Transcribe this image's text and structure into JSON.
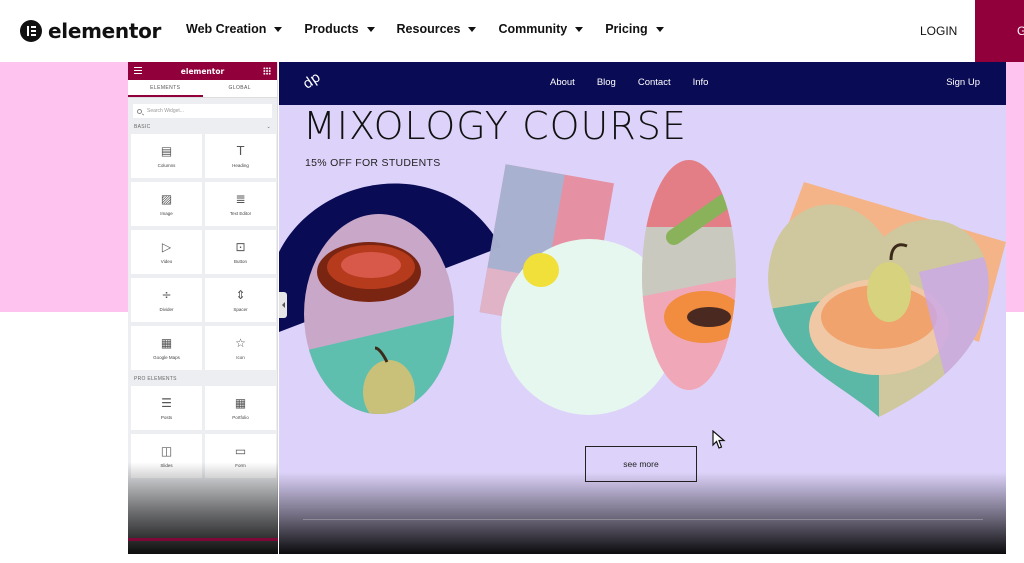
{
  "brand": {
    "name": "elementor"
  },
  "topnav": {
    "items": [
      {
        "label": "Web Creation"
      },
      {
        "label": "Products"
      },
      {
        "label": "Resources"
      },
      {
        "label": "Community"
      },
      {
        "label": "Pricing"
      }
    ],
    "login": "LOGIN",
    "cta_visible": "G"
  },
  "editor": {
    "title": "elementor",
    "tabs": [
      "ELEMENTS",
      "GLOBAL"
    ],
    "search_placeholder": "Search Widget...",
    "basic_label": "BASIC",
    "pro_label": "PRO ELEMENTS",
    "basic_widgets": [
      {
        "label": "Columns",
        "icon": "columns-icon",
        "glyph": "▤"
      },
      {
        "label": "Heading",
        "icon": "heading-icon",
        "glyph": "T"
      },
      {
        "label": "Image",
        "icon": "image-icon",
        "glyph": "▨"
      },
      {
        "label": "Text Editor",
        "icon": "text-editor-icon",
        "glyph": "≣"
      },
      {
        "label": "Video",
        "icon": "video-icon",
        "glyph": "▷"
      },
      {
        "label": "Button",
        "icon": "button-icon",
        "glyph": "⊡"
      },
      {
        "label": "Divider",
        "icon": "divider-icon",
        "glyph": "÷"
      },
      {
        "label": "Spacer",
        "icon": "spacer-icon",
        "glyph": "⇕"
      },
      {
        "label": "Google Maps",
        "icon": "map-icon",
        "glyph": "▦"
      },
      {
        "label": "Icon",
        "icon": "star-icon",
        "glyph": "☆"
      }
    ],
    "pro_widgets": [
      {
        "label": "Posts",
        "icon": "posts-icon",
        "glyph": "☰"
      },
      {
        "label": "Portfolio",
        "icon": "portfolio-icon",
        "glyph": "▦"
      },
      {
        "label": "Slides",
        "icon": "slides-icon",
        "glyph": "◫"
      },
      {
        "label": "Form",
        "icon": "form-icon",
        "glyph": "▭"
      }
    ]
  },
  "site": {
    "logo": "dp",
    "links": [
      "About",
      "Blog",
      "Contact",
      "Info"
    ],
    "signup": "Sign Up",
    "title": "MIXOLOGY COURSE",
    "subtitle": "15% OFF FOR STUDENTS",
    "button": "see more"
  },
  "colors": {
    "accent": "#92003b",
    "pink": "#ffc3ef",
    "site_nav": "#0a0b55",
    "site_bg": "#ddd3fa"
  }
}
